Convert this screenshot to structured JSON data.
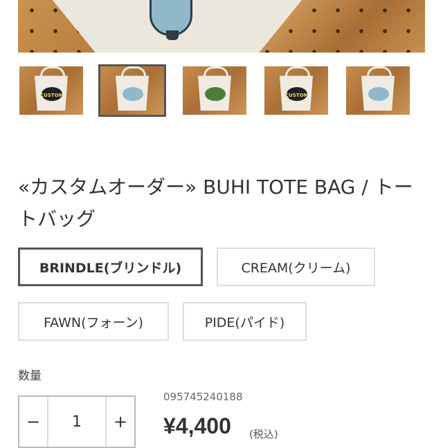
{
  "product": {
    "title": "«カスタムオーダー» BUHI TOTE BAG / トートバッグ",
    "sku": "095745240188",
    "price": "¥4,400",
    "tax_note": "(税込)"
  },
  "gallery": {
    "thumbnails": [
      {
        "label": "CUSTOM",
        "art_color": "#1e2225"
      },
      {
        "label": "",
        "art_color": "#8fb9c9"
      },
      {
        "label": "",
        "art_color": "#4e7d3a"
      },
      {
        "label": "CUSTOM",
        "art_color": "#1e2225"
      },
      {
        "label": "",
        "art_color": "#8fb9c9"
      }
    ],
    "selected_index": 1
  },
  "options": {
    "items": [
      "BRINDLE(ブリンドル)",
      "CREAM(クリーム)",
      "FAWN(フォーン)",
      "PIDE(パイド)"
    ],
    "selected": "BRINDLE(ブリンドル)"
  },
  "quantity": {
    "label": "数量",
    "value": "1",
    "minus": "−",
    "plus": "+"
  }
}
